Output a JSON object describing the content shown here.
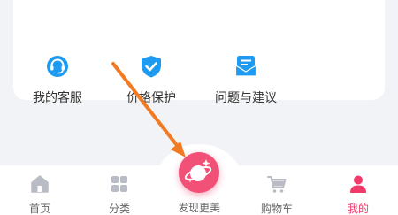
{
  "services": [
    {
      "label": "我的客服",
      "icon": "headset-icon"
    },
    {
      "label": "价格保护",
      "icon": "shield-check-icon"
    },
    {
      "label": "问题与建议",
      "icon": "message-icon"
    }
  ],
  "tabbar": {
    "tabs": [
      {
        "label": "首页",
        "icon": "home-icon"
      },
      {
        "label": "分类",
        "icon": "grid-icon"
      },
      {
        "label": "发现更美",
        "icon": "planet-sparkle-icon"
      },
      {
        "label": "购物车",
        "icon": "cart-icon"
      },
      {
        "label": "我的",
        "icon": "person-icon"
      }
    ],
    "active_index": 4
  },
  "colors": {
    "accent": "#f23a6a",
    "service_icon": "#1e9bf0",
    "tab_inactive": "#b9bcc4",
    "annotation_arrow": "#f27a23"
  }
}
